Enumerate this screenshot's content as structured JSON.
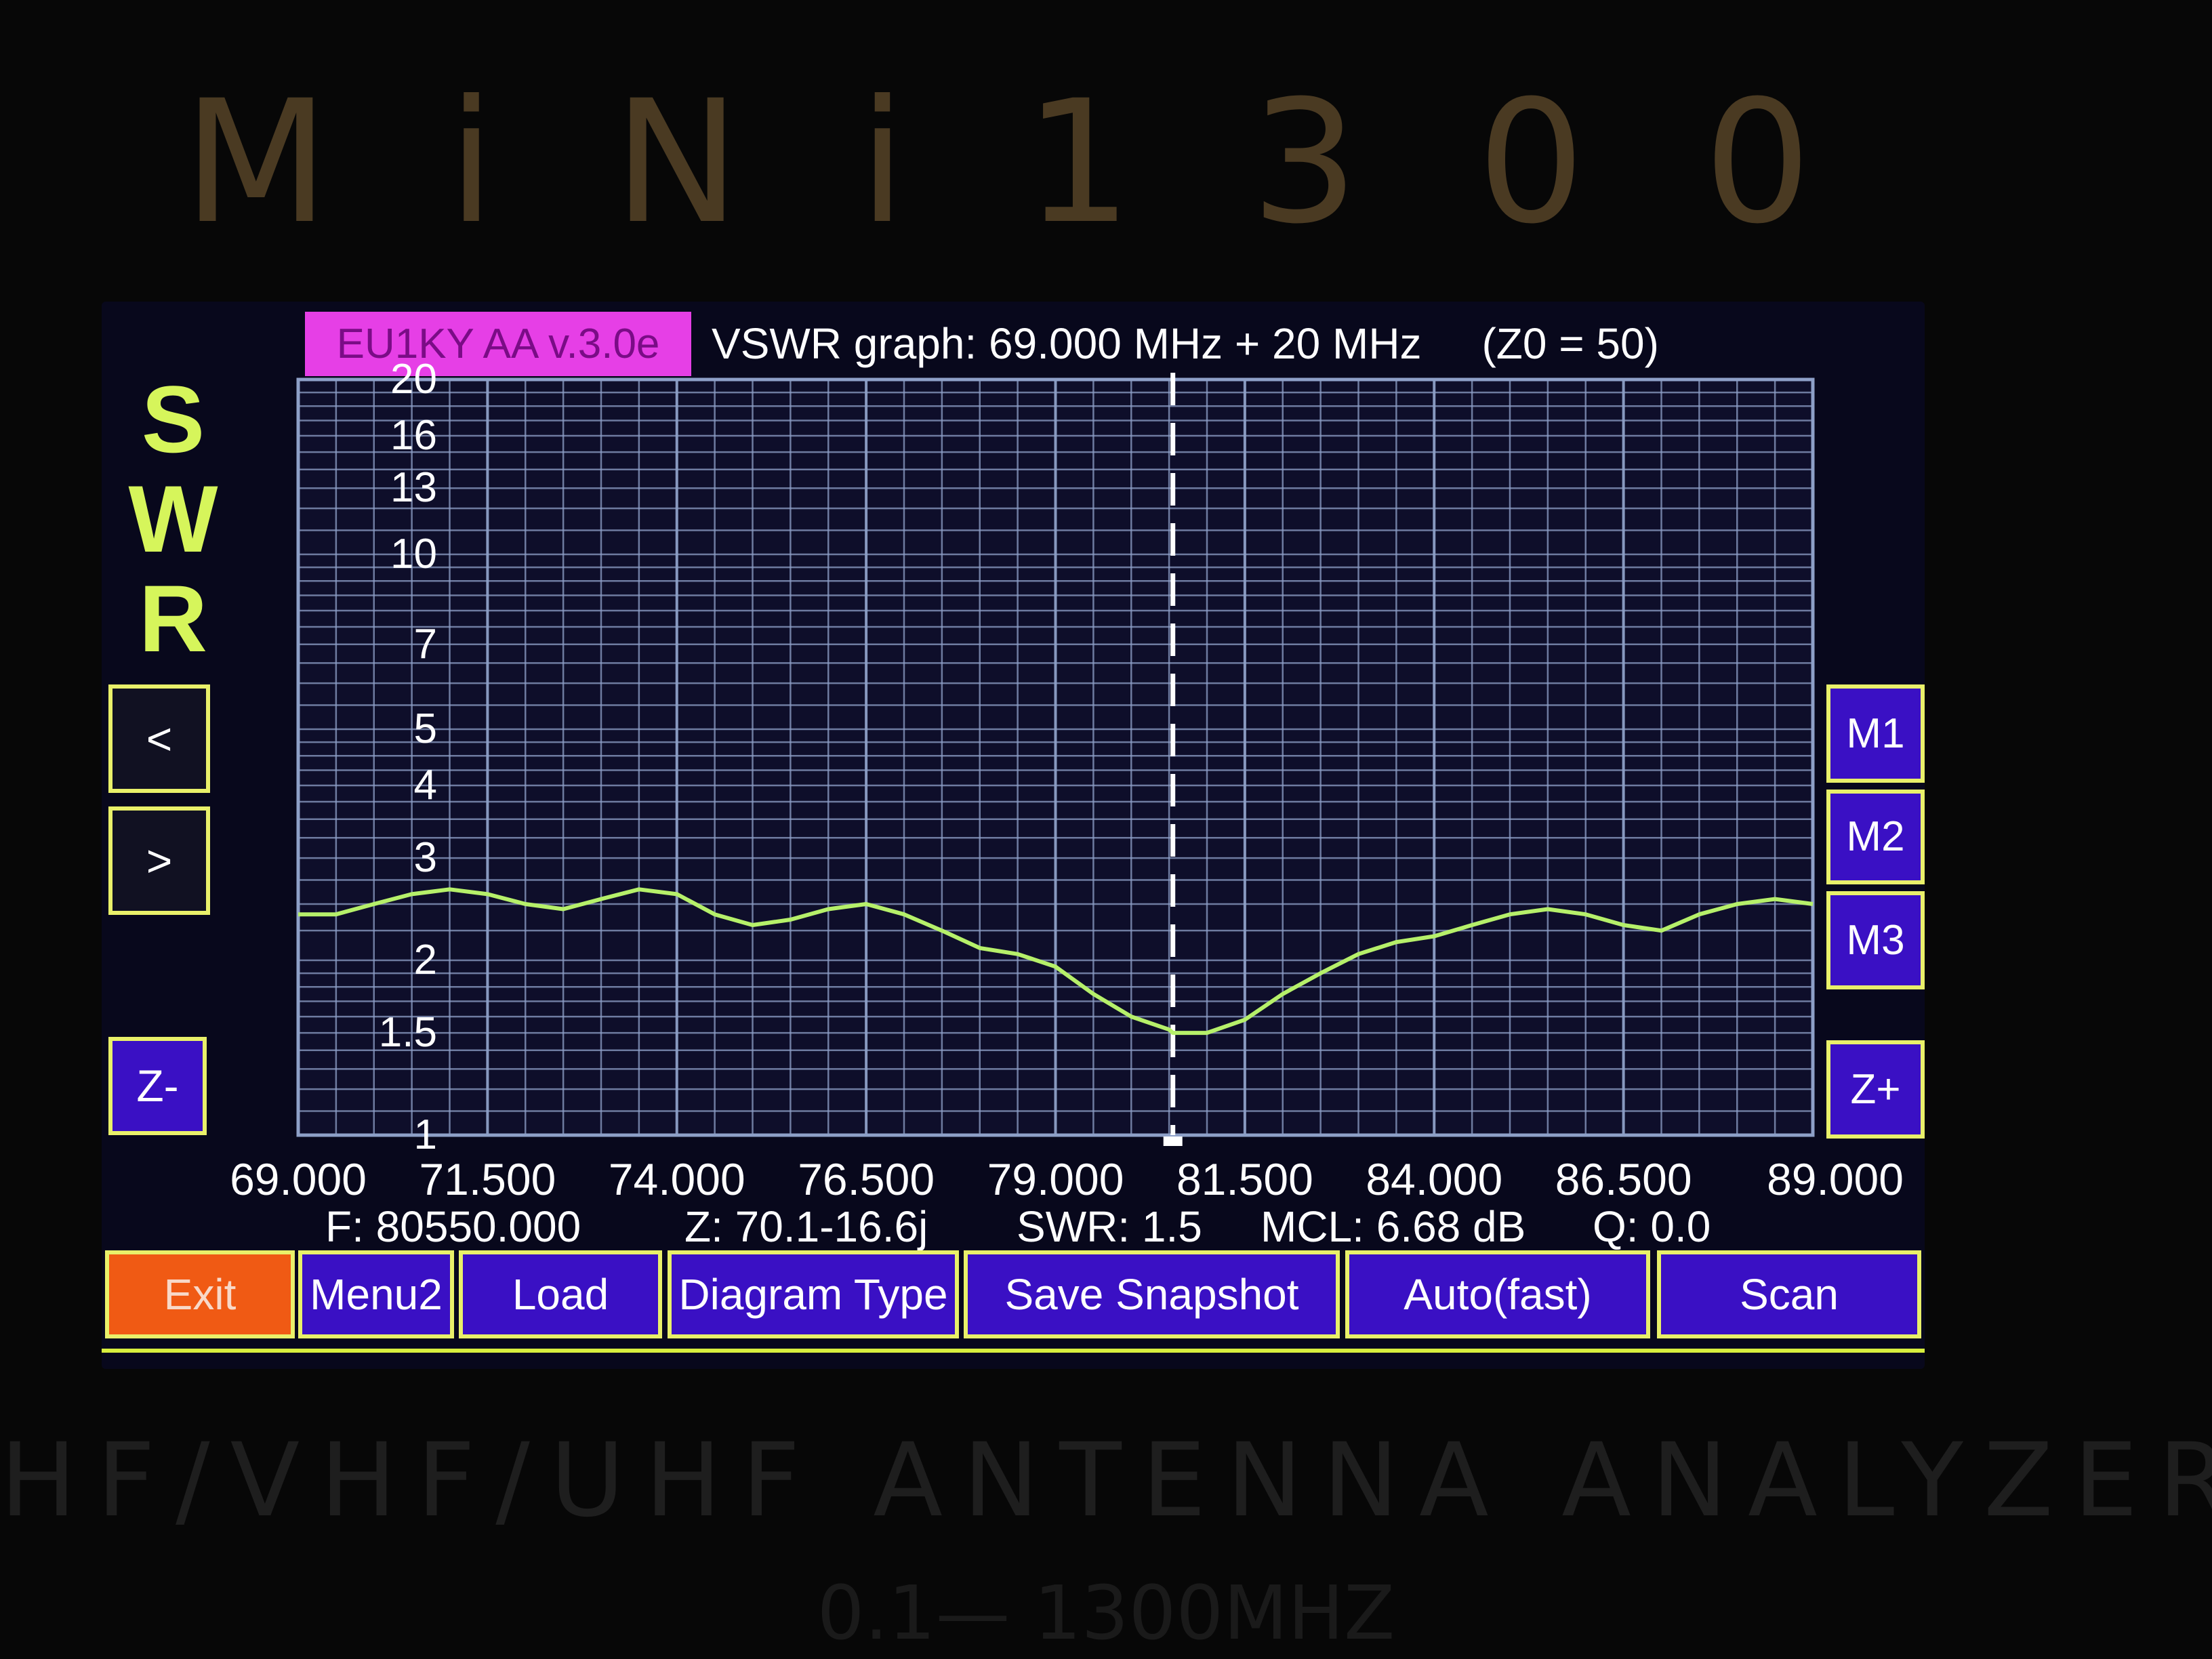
{
  "device": {
    "brand": "MiNi1300",
    "subtitle": "HF/VHF/UHF ANTENNA ANALYZER",
    "range": "0.1— 1300MHZ"
  },
  "header": {
    "version": "EU1KY AA v.3.0e",
    "title": "VSWR graph: 69.000 MHz + 20 MHz     (Z0 = 50)"
  },
  "left_panel": {
    "swr_label": "SWR",
    "prev_label": "<",
    "next_label": ">",
    "zoom_out_label": "Z-"
  },
  "right_panel": {
    "m1_label": "M1",
    "m2_label": "M2",
    "m3_label": "M3",
    "zoom_in_label": "Z+"
  },
  "status": {
    "freq": "F: 80550.000",
    "impedance": "Z: 70.1-16.6j",
    "swr": "SWR: 1.5",
    "mcl": "MCL: 6.68 dB",
    "q": "Q: 0.0"
  },
  "menu": {
    "exit": "Exit",
    "menu2": "Menu2",
    "load": "Load",
    "diagram_type": "Diagram Type",
    "save_snapshot": "Save Snapshot",
    "auto_fast": "Auto(fast)",
    "scan": "Scan"
  },
  "colors": {
    "trace": "#b6f06a",
    "grid": "#8ea0c8",
    "button_blue": "#3a10c4",
    "button_exit": "#f05a14",
    "accent_yellow": "#e9f06a",
    "badge_magenta": "#e63fe6"
  },
  "chart_data": {
    "type": "line",
    "xlabel": "",
    "ylabel": "SWR",
    "xlim": [
      69.0,
      89.0
    ],
    "ylim": [
      1,
      20
    ],
    "y_scale": "log",
    "grid": true,
    "x_ticks": [
      "69.000",
      "71.500",
      "74.000",
      "76.500",
      "79.000",
      "81.500",
      "84.000",
      "86.500",
      "89.000"
    ],
    "x_tick_values": [
      69.0,
      71.5,
      74.0,
      76.5,
      79.0,
      81.5,
      84.0,
      86.5,
      89.0
    ],
    "y_ticks": [
      "20",
      "16",
      "13",
      "10",
      "7",
      "5",
      "4",
      "3",
      "2",
      "1.5",
      "1"
    ],
    "y_tick_values": [
      20,
      16,
      13,
      10,
      7,
      5,
      4,
      3,
      2,
      1.5,
      1
    ],
    "cursor_x": 80.55,
    "series": [
      {
        "x": [
          69.0,
          69.5,
          70.0,
          70.5,
          71.0,
          71.5,
          72.0,
          72.5,
          73.0,
          73.5,
          74.0,
          74.5,
          75.0,
          75.5,
          76.0,
          76.5,
          77.0,
          77.5,
          78.0,
          78.5,
          79.0,
          79.5,
          80.0,
          80.5,
          80.55,
          81.0,
          81.5,
          82.0,
          82.5,
          83.0,
          83.5,
          84.0,
          84.5,
          85.0,
          85.5,
          86.0,
          86.5,
          87.0,
          87.5,
          88.0,
          88.5,
          89.0
        ],
        "values": [
          2.4,
          2.4,
          2.5,
          2.6,
          2.65,
          2.6,
          2.5,
          2.45,
          2.55,
          2.65,
          2.6,
          2.4,
          2.3,
          2.35,
          2.45,
          2.5,
          2.4,
          2.25,
          2.1,
          2.05,
          1.95,
          1.75,
          1.6,
          1.52,
          1.5,
          1.5,
          1.58,
          1.75,
          1.9,
          2.05,
          2.15,
          2.2,
          2.3,
          2.4,
          2.45,
          2.4,
          2.3,
          2.25,
          2.4,
          2.5,
          2.55,
          2.5
        ]
      }
    ]
  }
}
